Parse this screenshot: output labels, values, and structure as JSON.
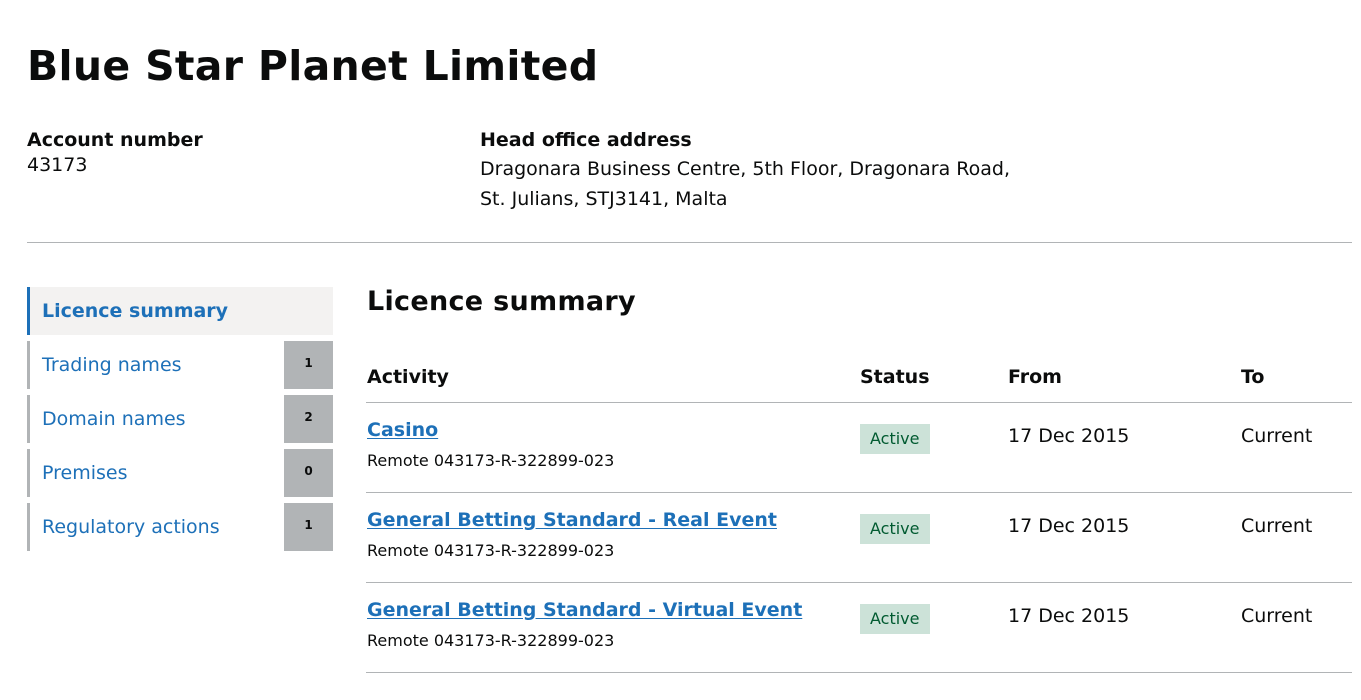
{
  "company": {
    "name": "Blue Star Planet Limited"
  },
  "account": {
    "label": "Account number",
    "value": "43173"
  },
  "head_office": {
    "label": "Head office address",
    "line1": "Dragonara Business Centre, 5th Floor, Dragonara Road,",
    "line2": "St. Julians, STJ3141, Malta"
  },
  "nav": {
    "items": [
      {
        "label": "Licence summary",
        "active": true,
        "count": null
      },
      {
        "label": "Trading names",
        "active": false,
        "count": "1"
      },
      {
        "label": "Domain names",
        "active": false,
        "count": "2"
      },
      {
        "label": "Premises",
        "active": false,
        "count": "0"
      },
      {
        "label": "Regulatory actions",
        "active": false,
        "count": "1"
      }
    ]
  },
  "main": {
    "title": "Licence summary",
    "table": {
      "headers": {
        "activity": "Activity",
        "status": "Status",
        "from": "From",
        "to": "To"
      },
      "rows": [
        {
          "activity": "Casino",
          "reference": "Remote 043173-R-322899-023",
          "status": "Active",
          "from": "17 Dec 2015",
          "to": "Current"
        },
        {
          "activity": "General Betting Standard - Real Event",
          "reference": "Remote 043173-R-322899-023",
          "status": "Active",
          "from": "17 Dec 2015",
          "to": "Current"
        },
        {
          "activity": "General Betting Standard - Virtual Event",
          "reference": "Remote 043173-R-322899-023",
          "status": "Active",
          "from": "17 Dec 2015",
          "to": "Current"
        }
      ]
    }
  },
  "colors": {
    "link": "#1d70b8",
    "text": "#0b0c0c",
    "border": "#b1b4b6",
    "active_nav_bg": "#f3f2f1",
    "status_bg": "#cce2d8",
    "status_text": "#005a30"
  }
}
